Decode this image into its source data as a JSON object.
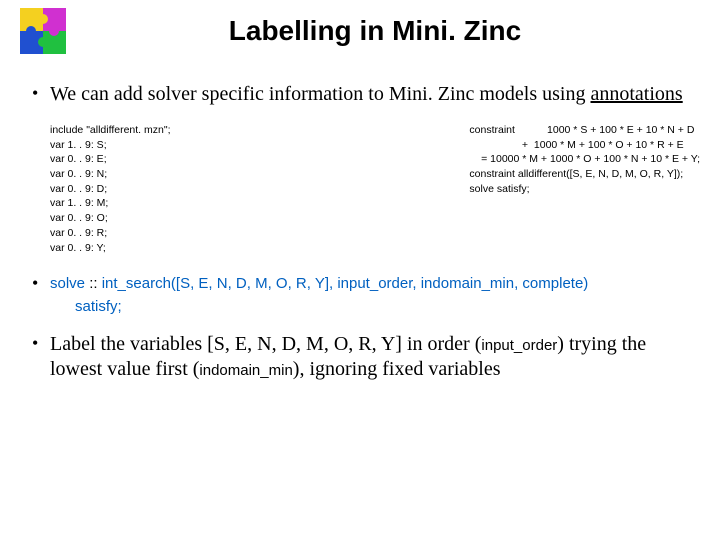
{
  "title": "Labelling in Mini. Zinc",
  "bullet1_a": "We can add solver specific information to Mini. Zinc models using ",
  "bullet1_b": "annotations",
  "code": {
    "left": [
      "include \"alldifferent. mzn\";",
      "var 1. . 9: S;",
      "var 0. . 9: E;",
      "var 0. . 9: N;",
      "var 0. . 9: D;",
      "var 1. . 9: M;",
      "var 0. . 9: O;",
      "var 0. . 9: R;",
      "var 0. . 9: Y;"
    ],
    "right": [
      "constraint           1000 * S + 100 * E + 10 * N + D",
      "                  +  1000 * M + 100 * O + 10 * R + E",
      "    = 10000 * M + 1000 * O + 100 * N + 10 * E + Y;",
      "",
      "constraint alldifferent([S, E, N, D, M, O, R, Y]);",
      "",
      "solve satisfy;"
    ]
  },
  "solve_kw1": "solve",
  "solve_cc": " :: ",
  "solve_fn": "int_search([S, E, N, D, M, O, R, Y], input_order, indomain_min, complete)",
  "solve_kw2": "satisfy;",
  "bullet3_a": "Label the variables [S, E, N, D, M, O, R, Y] in order (",
  "bullet3_b": "input_order",
  "bullet3_c": ") trying the lowest value first (",
  "bullet3_d": "indomain_min",
  "bullet3_e": "), ignoring fixed variables"
}
